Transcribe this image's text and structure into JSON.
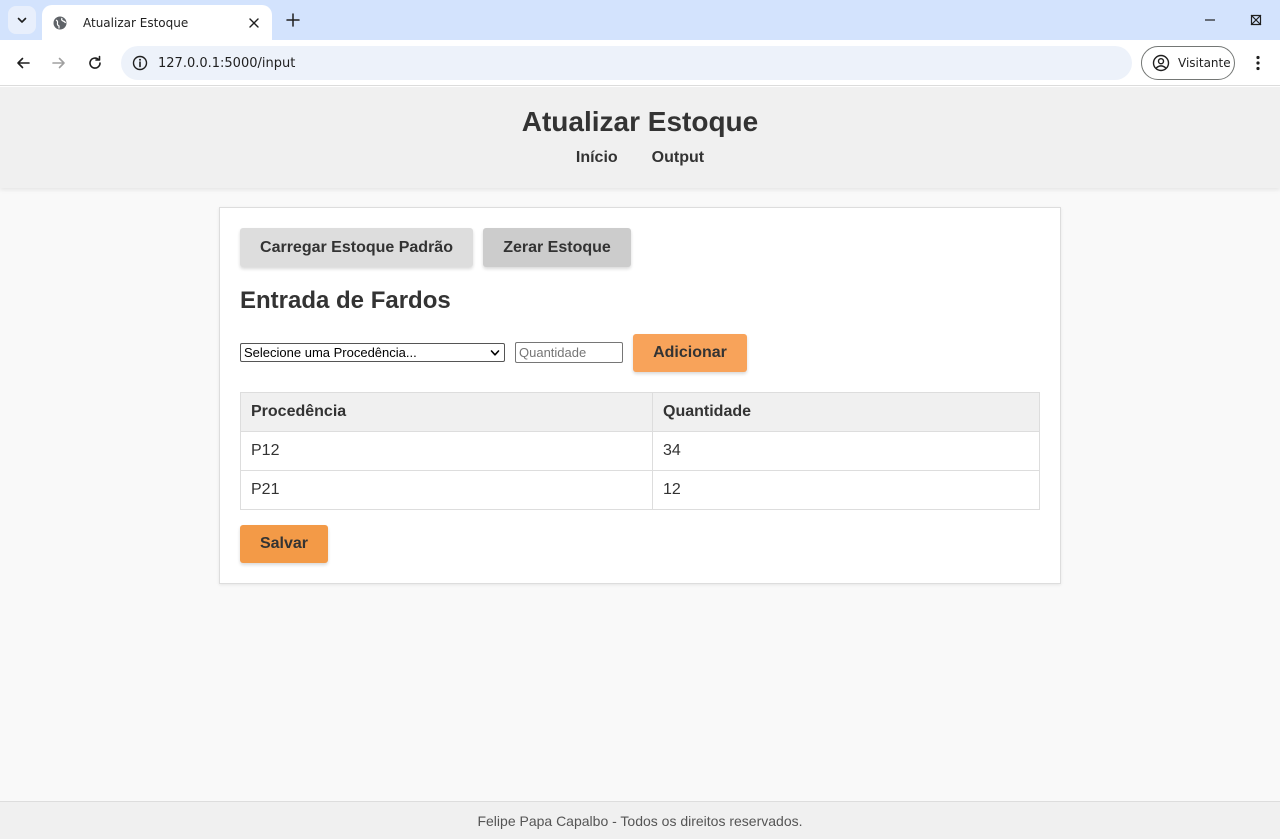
{
  "browser": {
    "tab_title": "Atualizar Estoque",
    "url": "127.0.0.1:5000/input",
    "profile_label": "Visitante"
  },
  "header": {
    "title": "Atualizar Estoque",
    "nav": [
      "Início",
      "Output"
    ]
  },
  "actions": {
    "load_default": "Carregar Estoque Padrão",
    "reset": "Zerar Estoque"
  },
  "section": {
    "title": "Entrada de Fardos"
  },
  "form": {
    "select_value": "Selecione uma Procedência...",
    "quantity_placeholder": "Quantidade",
    "add_label": "Adicionar"
  },
  "table": {
    "headers": [
      "Procedência",
      "Quantidade"
    ],
    "rows": [
      [
        "P12",
        "34"
      ],
      [
        "P21",
        "12"
      ]
    ]
  },
  "save_label": "Salvar",
  "footer": {
    "text": "Felipe Papa Capalbo - Todos os direitos reservados."
  },
  "colors": {
    "accent_orange": "#f8a35a",
    "save_orange": "#f39a47",
    "chrome_blue": "#d3e3fd"
  }
}
